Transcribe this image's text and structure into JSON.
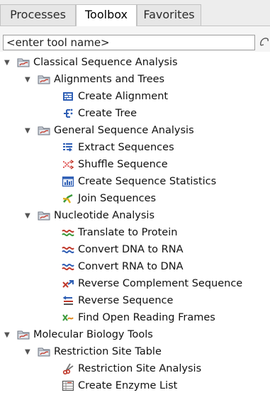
{
  "tabs": [
    {
      "label": "Processes",
      "active": false
    },
    {
      "label": "Toolbox",
      "active": true
    },
    {
      "label": "Favorites",
      "active": false
    }
  ],
  "search": {
    "placeholder": "<enter tool name>",
    "value": ""
  },
  "tree": [
    {
      "label": "Classical Sequence Analysis",
      "icon": "folder-icon",
      "expanded": true,
      "level": 0
    },
    {
      "label": "Alignments and Trees",
      "icon": "folder-icon",
      "expanded": true,
      "level": 1
    },
    {
      "label": "Create Alignment",
      "icon": "alignment-icon",
      "level": 2
    },
    {
      "label": "Create Tree",
      "icon": "tree-icon",
      "level": 2
    },
    {
      "label": "General Sequence Analysis",
      "icon": "folder-icon",
      "expanded": true,
      "level": 1
    },
    {
      "label": "Extract Sequences",
      "icon": "extract-icon",
      "level": 2
    },
    {
      "label": "Shuffle Sequence",
      "icon": "shuffle-icon",
      "level": 2
    },
    {
      "label": "Create Sequence Statistics",
      "icon": "statistics-icon",
      "level": 2
    },
    {
      "label": "Join Sequences",
      "icon": "join-icon",
      "level": 2
    },
    {
      "label": "Nucleotide Analysis",
      "icon": "folder-icon",
      "expanded": true,
      "level": 1
    },
    {
      "label": "Translate to Protein",
      "icon": "translate-icon",
      "level": 2
    },
    {
      "label": "Convert DNA to RNA",
      "icon": "dna-to-rna-icon",
      "level": 2
    },
    {
      "label": "Convert RNA to DNA",
      "icon": "rna-to-dna-icon",
      "level": 2
    },
    {
      "label": "Reverse Complement Sequence",
      "icon": "reverse-complement-icon",
      "level": 2
    },
    {
      "label": "Reverse Sequence",
      "icon": "reverse-icon",
      "level": 2
    },
    {
      "label": "Find Open Reading Frames",
      "icon": "orf-icon",
      "level": 2
    },
    {
      "label": "Molecular Biology Tools",
      "icon": "folder-icon",
      "expanded": true,
      "level": 0
    },
    {
      "label": "Restriction Site Table",
      "icon": "folder-icon",
      "expanded": true,
      "level": 1
    },
    {
      "label": "Restriction Site Analysis",
      "icon": "scissors-icon",
      "level": 2
    },
    {
      "label": "Create Enzyme List",
      "icon": "enzyme-list-icon",
      "level": 2
    }
  ]
}
